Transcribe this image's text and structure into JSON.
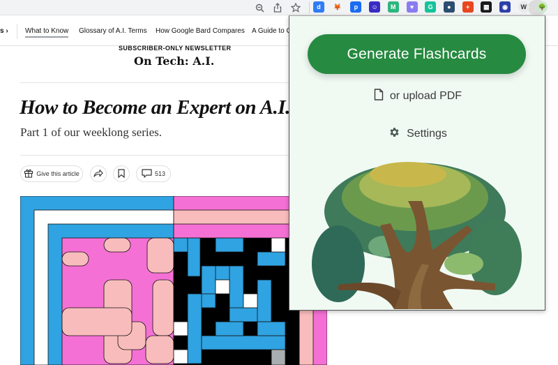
{
  "browser": {
    "toolbar_icons": [
      "zoom-out-icon",
      "share-icon",
      "bookmark-star-icon"
    ],
    "extensions": [
      {
        "name": "d-extension",
        "glyph": "d",
        "color": "#2f7cf6"
      },
      {
        "name": "metamask-fox",
        "glyph": "🦊",
        "color": "#f2f3f4"
      },
      {
        "name": "p-extension",
        "glyph": "p",
        "color": "#1a6cf0"
      },
      {
        "name": "ghost-face-extension",
        "glyph": "☺",
        "color": "#3a2bc4"
      },
      {
        "name": "m-extension",
        "glyph": "M",
        "color": "#2eb67d"
      },
      {
        "name": "purple-heart-extension",
        "glyph": "♥",
        "color": "#8a7cf0"
      },
      {
        "name": "grammarly-extension",
        "glyph": "G",
        "color": "#15c39a"
      },
      {
        "name": "dots-extension",
        "glyph": "●",
        "color": "#2d4d70"
      },
      {
        "name": "plus-extension",
        "glyph": "+",
        "color": "#e8461f"
      },
      {
        "name": "grid-extension",
        "glyph": "▦",
        "color": "#1a1a1a"
      },
      {
        "name": "colorful-extension",
        "glyph": "◉",
        "color": "#2d3fa8"
      },
      {
        "name": "w-extension",
        "glyph": "W",
        "color": "#e9e9e9"
      },
      {
        "name": "tree-flashcards-extension",
        "glyph": "🌳",
        "color": "#cfe8cf"
      },
      {
        "name": "puzzle-extensions",
        "glyph": "✱",
        "color": "#f1f3f4"
      }
    ]
  },
  "subnav": {
    "partial_left": "s ›",
    "items": [
      {
        "label": "What to Know",
        "active": true
      },
      {
        "label": "Glossary of A.I. Terms",
        "active": false
      },
      {
        "label": "How Google Bard Compares",
        "active": false
      },
      {
        "label": "A Guide to G",
        "active": false
      }
    ]
  },
  "article": {
    "kicker": "SUBSCRIBER-ONLY NEWSLETTER",
    "column": "On Tech: A.I.",
    "headline": "How to Become an Expert on A.I.",
    "dek": "Part 1 of our weeklong series.",
    "actions": {
      "give_label": "Give this article",
      "comments_count": "513"
    }
  },
  "popup": {
    "primary_button": "Generate Flashcards",
    "upload_label": "or upload PDF",
    "settings_label": "Settings",
    "accent_color": "#268a40",
    "background_color": "#f0faf3"
  },
  "maze_colors": {
    "blue": "#30a3e2",
    "pink": "#f570d4",
    "light_pink": "#f9bcbc",
    "white": "#ffffff",
    "black": "#000000",
    "gray": "#a8adb1",
    "green": "#268a40"
  }
}
